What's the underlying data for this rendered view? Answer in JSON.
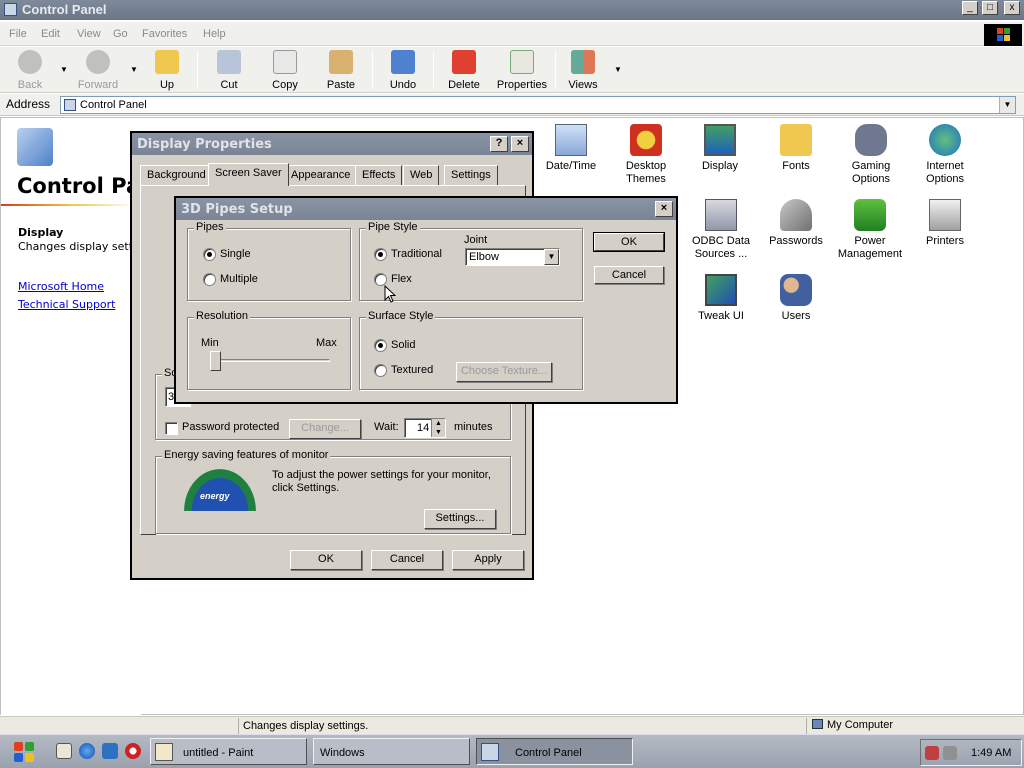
{
  "window": {
    "title": "Control Panel",
    "controls": [
      "_",
      "□",
      "x"
    ]
  },
  "menu": [
    "File",
    "Edit",
    "View",
    "Go",
    "Favorites",
    "Help"
  ],
  "toolbar": {
    "back": "Back",
    "forward": "Forward",
    "up": "Up",
    "cut": "Cut",
    "copy": "Copy",
    "paste": "Paste",
    "undo": "Undo",
    "delete": "Delete",
    "properties": "Properties",
    "views": "Views"
  },
  "address": {
    "label": "Address",
    "value": "Control Panel"
  },
  "left_pane": {
    "heading": "Control Panel",
    "selected_title": "Display",
    "selected_desc": "Changes display settings.",
    "links": [
      "Microsoft Home",
      "Technical Support"
    ]
  },
  "items": [
    {
      "label": "Date/Time",
      "icon": "calendar-clock-icon"
    },
    {
      "label": "Desktop Themes",
      "icon": "desktop-themes-icon"
    },
    {
      "label": "Display",
      "icon": "display-monitor-icon"
    },
    {
      "label": "Fonts",
      "icon": "fonts-folder-icon"
    },
    {
      "label": "Gaming Options",
      "icon": "gamepad-icon"
    },
    {
      "label": "Internet Options",
      "icon": "globe-icon"
    },
    {
      "label": "ODBC Data Sources ...",
      "icon": "database-icon"
    },
    {
      "label": "Passwords",
      "icon": "keys-icon"
    },
    {
      "label": "Power Management",
      "icon": "power-icon"
    },
    {
      "label": "Printers",
      "icon": "printer-icon"
    },
    {
      "label": "Tweak UI",
      "icon": "tweak-ui-icon"
    },
    {
      "label": "Users",
      "icon": "users-icon"
    }
  ],
  "display_properties": {
    "title": "Display Properties",
    "tabs": [
      "Background",
      "Screen Saver",
      "Appearance",
      "Effects",
      "Web",
      "Settings"
    ],
    "selected_tab": "Screen Saver",
    "screensaver_group": "Sc",
    "screensaver_value": "3D",
    "password_protected": "Password protected",
    "change_button": "Change...",
    "wait_label": "Wait:",
    "wait_value": "14",
    "wait_unit": "minutes",
    "energy_group": "Energy saving features of monitor",
    "energy_text": "To adjust the power settings for your monitor, click Settings.",
    "energy_logo_text": "energy",
    "settings_button": "Settings...",
    "ok": "OK",
    "cancel": "Cancel",
    "apply": "Apply"
  },
  "pipes_setup": {
    "title": "3D Pipes Setup",
    "pipes_group": "Pipes",
    "single": "Single",
    "multiple": "Multiple",
    "pipe_style_group": "Pipe Style",
    "traditional": "Traditional",
    "flex": "Flex",
    "joint_label": "Joint",
    "joint_value": "Elbow",
    "resolution_group": "Resolution",
    "min": "Min",
    "max": "Max",
    "resolution_level": 0,
    "surface_group": "Surface Style",
    "solid": "Solid",
    "textured": "Textured",
    "choose_texture": "Choose Texture...",
    "ok": "OK",
    "cancel": "Cancel"
  },
  "status": {
    "text": "Changes display settings.",
    "zone": "My Computer"
  },
  "taskbar": {
    "tasks": [
      "untitled - Paint",
      "Windows",
      "Control Panel"
    ],
    "active_task": "Control Panel",
    "clock": "1:49 AM"
  }
}
